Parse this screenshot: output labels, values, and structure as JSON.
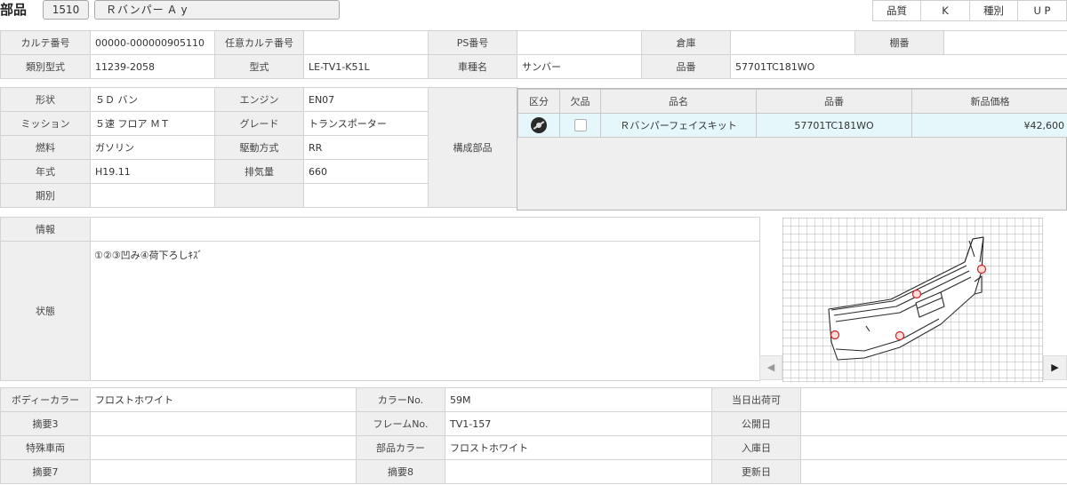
{
  "header": {
    "title": "部品",
    "code": "1510",
    "part_name": "Ｒバンパー A y",
    "quality_label": "品質",
    "quality_value": "K",
    "kind_label": "種別",
    "kind_value": "U P"
  },
  "top": {
    "karte_no_label": "カルテ番号",
    "karte_no": "00000-000000905110",
    "opt_karte_label": "任意カルテ番号",
    "opt_karte": "",
    "ps_label": "PS番号",
    "ps_no": "",
    "warehouse_label": "倉庫",
    "warehouse": "",
    "shelf_label": "棚番",
    "shelf": "",
    "class_label": "類別型式",
    "class_value": "11239-2058",
    "model_label": "型式",
    "model_value": "LE-TV1-K51L",
    "car_name_label": "車種名",
    "car_name": "サンバー",
    "part_no_label": "品番",
    "part_no": "57701TC181WO"
  },
  "spec": {
    "shape_label": "形状",
    "shape": "５Ｄ バン",
    "engine_label": "エンジン",
    "engine": "EN07",
    "mission_label": "ミッション",
    "mission": "５速 フロア ＭＴ",
    "grade_label": "グレード",
    "grade": "トランスポーター",
    "fuel_label": "燃料",
    "fuel": "ガソリン",
    "drive_label": "駆動方式",
    "drive": "RR",
    "year_label": "年式",
    "year": "H19.11",
    "displacement_label": "排気量",
    "displacement": "660",
    "period_label": "期別",
    "period": "",
    "components_label": "構成部品"
  },
  "parts": {
    "headers": [
      "区分",
      "欠品",
      "品名",
      "品番",
      "新品価格"
    ],
    "rows": [
      {
        "name": "Ｒバンパーフェイスキット",
        "number": "57701TC181WO",
        "price": "¥42,600"
      }
    ]
  },
  "info": {
    "info_label": "情報",
    "info_value": "",
    "state_label": "状態",
    "state_value": "①②③凹み④荷下ろしｷｽﾞ"
  },
  "bottom": {
    "body_color_label": "ボディーカラー",
    "body_color": "フロストホワイト",
    "color_no_label": "カラーNo.",
    "color_no": "59M",
    "ship_label": "当日出荷可",
    "memo3_label": "摘要3",
    "frame_label": "フレームNo.",
    "frame_no": "TV1-157",
    "publish_label": "公開日",
    "special_label": "特殊車両",
    "part_color_label": "部品カラー",
    "part_color": "フロストホワイト",
    "stock_label": "入庫日",
    "memo7_label": "摘要7",
    "memo8_label": "摘要8",
    "update_label": "更新日"
  },
  "image": {
    "nav_prev": "◀",
    "nav_next": "▶",
    "marks": [
      "①",
      "②",
      "③",
      "④"
    ]
  }
}
